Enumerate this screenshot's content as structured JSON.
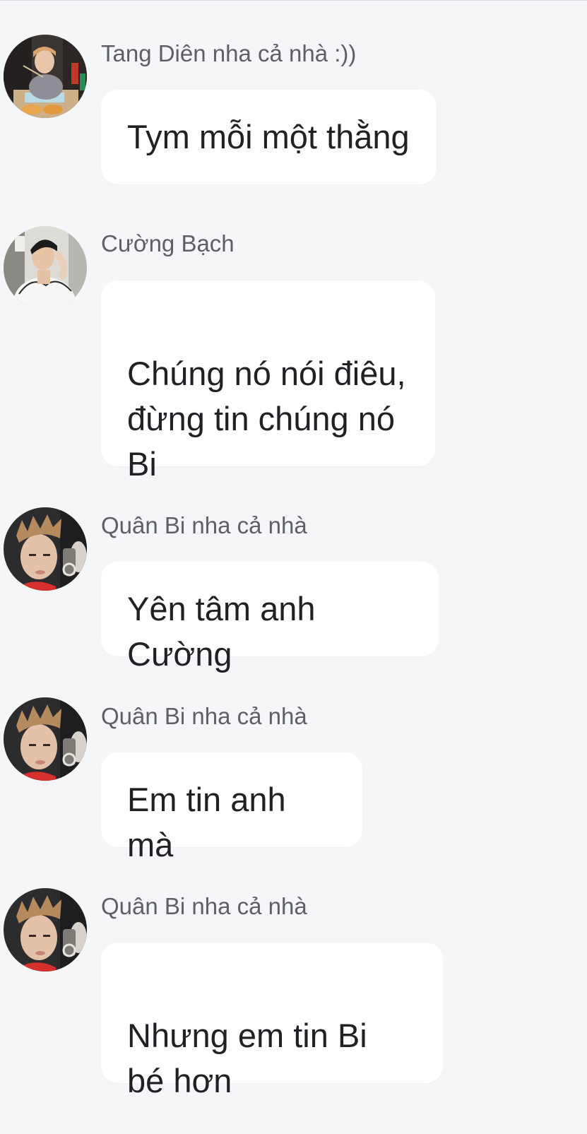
{
  "messages": [
    {
      "sender": "Tang Diên nha cả nhà :))",
      "text": "Tym mỗi một thằng",
      "avatar": "tang-dien-avatar"
    },
    {
      "sender": "Cường Bạch",
      "text": "Chúng nó nói điêu,\nđừng tin chúng nó\nBi",
      "avatar": "cuong-bach-avatar"
    },
    {
      "sender": "Quân Bi nha cả nhà",
      "text": "Yên tâm anh Cường",
      "avatar": "quan-bi-avatar"
    },
    {
      "sender": "Quân Bi nha cả nhà",
      "text": "Em tin anh mà",
      "avatar": "quan-bi-avatar"
    },
    {
      "sender": "Quân Bi nha cả nhà",
      "text": "Nhưng em tin Bi\nbé hơn",
      "avatar": "quan-bi-avatar"
    }
  ],
  "colors": {
    "background": "#f5f6f8",
    "bubble": "#ffffff",
    "sender_text": "#5d6066",
    "message_text": "#1f2124"
  }
}
